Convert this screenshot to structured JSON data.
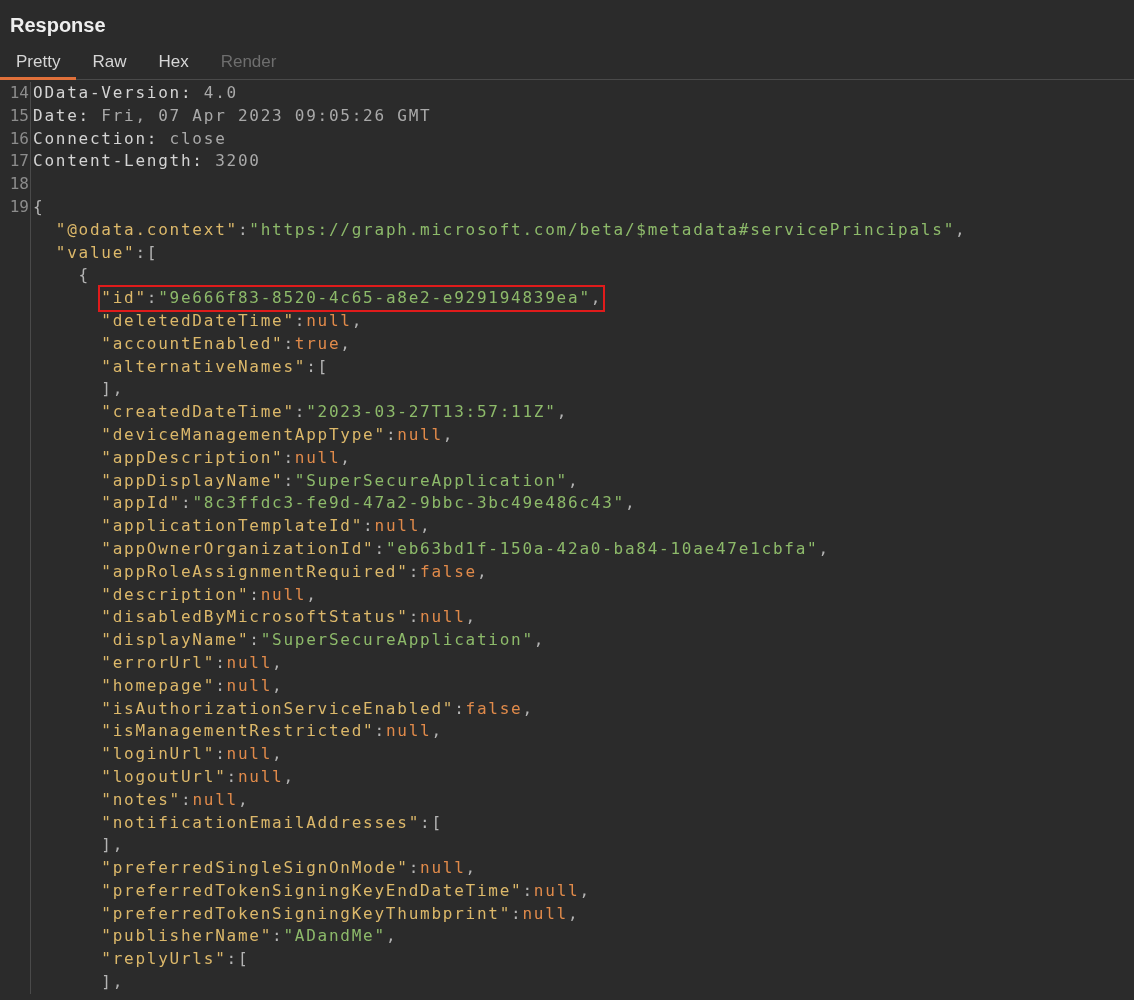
{
  "panel": {
    "title": "Response"
  },
  "tabs": [
    {
      "label": "Pretty",
      "selected": true,
      "disabled": false
    },
    {
      "label": "Raw",
      "selected": false,
      "disabled": false
    },
    {
      "label": "Hex",
      "selected": false,
      "disabled": false
    },
    {
      "label": "Render",
      "selected": false,
      "disabled": true
    }
  ],
  "lines": [
    {
      "number": "14",
      "boxed": false,
      "tokens": [
        {
          "kind": "hname",
          "text": "OData-Version:"
        },
        {
          "kind": "hval",
          "text": " 4.0"
        }
      ]
    },
    {
      "number": "15",
      "boxed": false,
      "tokens": [
        {
          "kind": "hname",
          "text": "Date:"
        },
        {
          "kind": "hval",
          "text": " Fri, 07 Apr 2023 09:05:26 GMT"
        }
      ]
    },
    {
      "number": "16",
      "boxed": false,
      "tokens": [
        {
          "kind": "hname",
          "text": "Connection:"
        },
        {
          "kind": "hval",
          "text": " close"
        }
      ]
    },
    {
      "number": "17",
      "boxed": false,
      "tokens": [
        {
          "kind": "hname",
          "text": "Content-Length:"
        },
        {
          "kind": "hval",
          "text": " 3200"
        }
      ]
    },
    {
      "number": "18",
      "boxed": false
    },
    {
      "number": "19",
      "boxed": false,
      "tokens": [
        {
          "kind": "punct",
          "text": "{"
        }
      ]
    },
    {
      "boxed": false,
      "tokens": [
        {
          "kind": "key",
          "text": "  \"@odata.context\""
        },
        {
          "kind": "punct",
          "text": ":"
        },
        {
          "kind": "str",
          "text": "\"https://graph.microsoft.com/beta/$metadata#servicePrincipals\""
        },
        {
          "kind": "punct",
          "text": ","
        }
      ]
    },
    {
      "boxed": false,
      "tokens": [
        {
          "kind": "key",
          "text": "  \"value\""
        },
        {
          "kind": "punct",
          "text": ":["
        }
      ]
    },
    {
      "boxed": false,
      "tokens": [
        {
          "kind": "punct",
          "text": "    {"
        }
      ]
    },
    {
      "boxed": true,
      "tokens": [
        {
          "kind": "key",
          "text": "      \"id\""
        },
        {
          "kind": "punct",
          "text": ":"
        },
        {
          "kind": "str",
          "text": "\"9e666f83-8520-4c65-a8e2-e929194839ea\""
        },
        {
          "kind": "punct",
          "text": ","
        }
      ]
    },
    {
      "boxed": false,
      "tokens": [
        {
          "kind": "key",
          "text": "      \"deletedDateTime\""
        },
        {
          "kind": "punct",
          "text": ":"
        },
        {
          "kind": "lit",
          "text": "null"
        },
        {
          "kind": "punct",
          "text": ","
        }
      ]
    },
    {
      "boxed": false,
      "tokens": [
        {
          "kind": "key",
          "text": "      \"accountEnabled\""
        },
        {
          "kind": "punct",
          "text": ":"
        },
        {
          "kind": "lit",
          "text": "true"
        },
        {
          "kind": "punct",
          "text": ","
        }
      ]
    },
    {
      "boxed": false,
      "tokens": [
        {
          "kind": "key",
          "text": "      \"alternativeNames\""
        },
        {
          "kind": "punct",
          "text": ":["
        }
      ]
    },
    {
      "boxed": false,
      "tokens": [
        {
          "kind": "punct",
          "text": "      ],"
        }
      ]
    },
    {
      "boxed": false,
      "tokens": [
        {
          "kind": "key",
          "text": "      \"createdDateTime\""
        },
        {
          "kind": "punct",
          "text": ":"
        },
        {
          "kind": "str",
          "text": "\"2023-03-27T13:57:11Z\""
        },
        {
          "kind": "punct",
          "text": ","
        }
      ]
    },
    {
      "boxed": false,
      "tokens": [
        {
          "kind": "key",
          "text": "      \"deviceManagementAppType\""
        },
        {
          "kind": "punct",
          "text": ":"
        },
        {
          "kind": "lit",
          "text": "null"
        },
        {
          "kind": "punct",
          "text": ","
        }
      ]
    },
    {
      "boxed": false,
      "tokens": [
        {
          "kind": "key",
          "text": "      \"appDescription\""
        },
        {
          "kind": "punct",
          "text": ":"
        },
        {
          "kind": "lit",
          "text": "null"
        },
        {
          "kind": "punct",
          "text": ","
        }
      ]
    },
    {
      "boxed": false,
      "tokens": [
        {
          "kind": "key",
          "text": "      \"appDisplayName\""
        },
        {
          "kind": "punct",
          "text": ":"
        },
        {
          "kind": "str",
          "text": "\"SuperSecureApplication\""
        },
        {
          "kind": "punct",
          "text": ","
        }
      ]
    },
    {
      "boxed": false,
      "tokens": [
        {
          "kind": "key",
          "text": "      \"appId\""
        },
        {
          "kind": "punct",
          "text": ":"
        },
        {
          "kind": "str",
          "text": "\"8c3ffdc3-fe9d-47a2-9bbc-3bc49e486c43\""
        },
        {
          "kind": "punct",
          "text": ","
        }
      ]
    },
    {
      "boxed": false,
      "tokens": [
        {
          "kind": "key",
          "text": "      \"applicationTemplateId\""
        },
        {
          "kind": "punct",
          "text": ":"
        },
        {
          "kind": "lit",
          "text": "null"
        },
        {
          "kind": "punct",
          "text": ","
        }
      ]
    },
    {
      "boxed": false,
      "tokens": [
        {
          "kind": "key",
          "text": "      \"appOwnerOrganizationId\""
        },
        {
          "kind": "punct",
          "text": ":"
        },
        {
          "kind": "str",
          "text": "\"eb63bd1f-150a-42a0-ba84-10ae47e1cbfa\""
        },
        {
          "kind": "punct",
          "text": ","
        }
      ]
    },
    {
      "boxed": false,
      "tokens": [
        {
          "kind": "key",
          "text": "      \"appRoleAssignmentRequired\""
        },
        {
          "kind": "punct",
          "text": ":"
        },
        {
          "kind": "lit",
          "text": "false"
        },
        {
          "kind": "punct",
          "text": ","
        }
      ]
    },
    {
      "boxed": false,
      "tokens": [
        {
          "kind": "key",
          "text": "      \"description\""
        },
        {
          "kind": "punct",
          "text": ":"
        },
        {
          "kind": "lit",
          "text": "null"
        },
        {
          "kind": "punct",
          "text": ","
        }
      ]
    },
    {
      "boxed": false,
      "tokens": [
        {
          "kind": "key",
          "text": "      \"disabledByMicrosoftStatus\""
        },
        {
          "kind": "punct",
          "text": ":"
        },
        {
          "kind": "lit",
          "text": "null"
        },
        {
          "kind": "punct",
          "text": ","
        }
      ]
    },
    {
      "boxed": false,
      "tokens": [
        {
          "kind": "key",
          "text": "      \"displayName\""
        },
        {
          "kind": "punct",
          "text": ":"
        },
        {
          "kind": "str",
          "text": "\"SuperSecureApplication\""
        },
        {
          "kind": "punct",
          "text": ","
        }
      ]
    },
    {
      "boxed": false,
      "tokens": [
        {
          "kind": "key",
          "text": "      \"errorUrl\""
        },
        {
          "kind": "punct",
          "text": ":"
        },
        {
          "kind": "lit",
          "text": "null"
        },
        {
          "kind": "punct",
          "text": ","
        }
      ]
    },
    {
      "boxed": false,
      "tokens": [
        {
          "kind": "key",
          "text": "      \"homepage\""
        },
        {
          "kind": "punct",
          "text": ":"
        },
        {
          "kind": "lit",
          "text": "null"
        },
        {
          "kind": "punct",
          "text": ","
        }
      ]
    },
    {
      "boxed": false,
      "tokens": [
        {
          "kind": "key",
          "text": "      \"isAuthorizationServiceEnabled\""
        },
        {
          "kind": "punct",
          "text": ":"
        },
        {
          "kind": "lit",
          "text": "false"
        },
        {
          "kind": "punct",
          "text": ","
        }
      ]
    },
    {
      "boxed": false,
      "tokens": [
        {
          "kind": "key",
          "text": "      \"isManagementRestricted\""
        },
        {
          "kind": "punct",
          "text": ":"
        },
        {
          "kind": "lit",
          "text": "null"
        },
        {
          "kind": "punct",
          "text": ","
        }
      ]
    },
    {
      "boxed": false,
      "tokens": [
        {
          "kind": "key",
          "text": "      \"loginUrl\""
        },
        {
          "kind": "punct",
          "text": ":"
        },
        {
          "kind": "lit",
          "text": "null"
        },
        {
          "kind": "punct",
          "text": ","
        }
      ]
    },
    {
      "boxed": false,
      "tokens": [
        {
          "kind": "key",
          "text": "      \"logoutUrl\""
        },
        {
          "kind": "punct",
          "text": ":"
        },
        {
          "kind": "lit",
          "text": "null"
        },
        {
          "kind": "punct",
          "text": ","
        }
      ]
    },
    {
      "boxed": false,
      "tokens": [
        {
          "kind": "key",
          "text": "      \"notes\""
        },
        {
          "kind": "punct",
          "text": ":"
        },
        {
          "kind": "lit",
          "text": "null"
        },
        {
          "kind": "punct",
          "text": ","
        }
      ]
    },
    {
      "boxed": false,
      "tokens": [
        {
          "kind": "key",
          "text": "      \"notificationEmailAddresses\""
        },
        {
          "kind": "punct",
          "text": ":["
        }
      ]
    },
    {
      "boxed": false,
      "tokens": [
        {
          "kind": "punct",
          "text": "      ],"
        }
      ]
    },
    {
      "boxed": false,
      "tokens": [
        {
          "kind": "key",
          "text": "      \"preferredSingleSignOnMode\""
        },
        {
          "kind": "punct",
          "text": ":"
        },
        {
          "kind": "lit",
          "text": "null"
        },
        {
          "kind": "punct",
          "text": ","
        }
      ]
    },
    {
      "boxed": false,
      "tokens": [
        {
          "kind": "key",
          "text": "      \"preferredTokenSigningKeyEndDateTime\""
        },
        {
          "kind": "punct",
          "text": ":"
        },
        {
          "kind": "lit",
          "text": "null"
        },
        {
          "kind": "punct",
          "text": ","
        }
      ]
    },
    {
      "boxed": false,
      "tokens": [
        {
          "kind": "key",
          "text": "      \"preferredTokenSigningKeyThumbprint\""
        },
        {
          "kind": "punct",
          "text": ":"
        },
        {
          "kind": "lit",
          "text": "null"
        },
        {
          "kind": "punct",
          "text": ","
        }
      ]
    },
    {
      "boxed": false,
      "tokens": [
        {
          "kind": "key",
          "text": "      \"publisherName\""
        },
        {
          "kind": "punct",
          "text": ":"
        },
        {
          "kind": "str",
          "text": "\"ADandMe\""
        },
        {
          "kind": "punct",
          "text": ","
        }
      ]
    },
    {
      "boxed": false,
      "tokens": [
        {
          "kind": "key",
          "text": "      \"replyUrls\""
        },
        {
          "kind": "punct",
          "text": ":["
        }
      ]
    },
    {
      "boxed": false,
      "tokens": [
        {
          "kind": "punct",
          "text": "      ],"
        }
      ]
    }
  ]
}
